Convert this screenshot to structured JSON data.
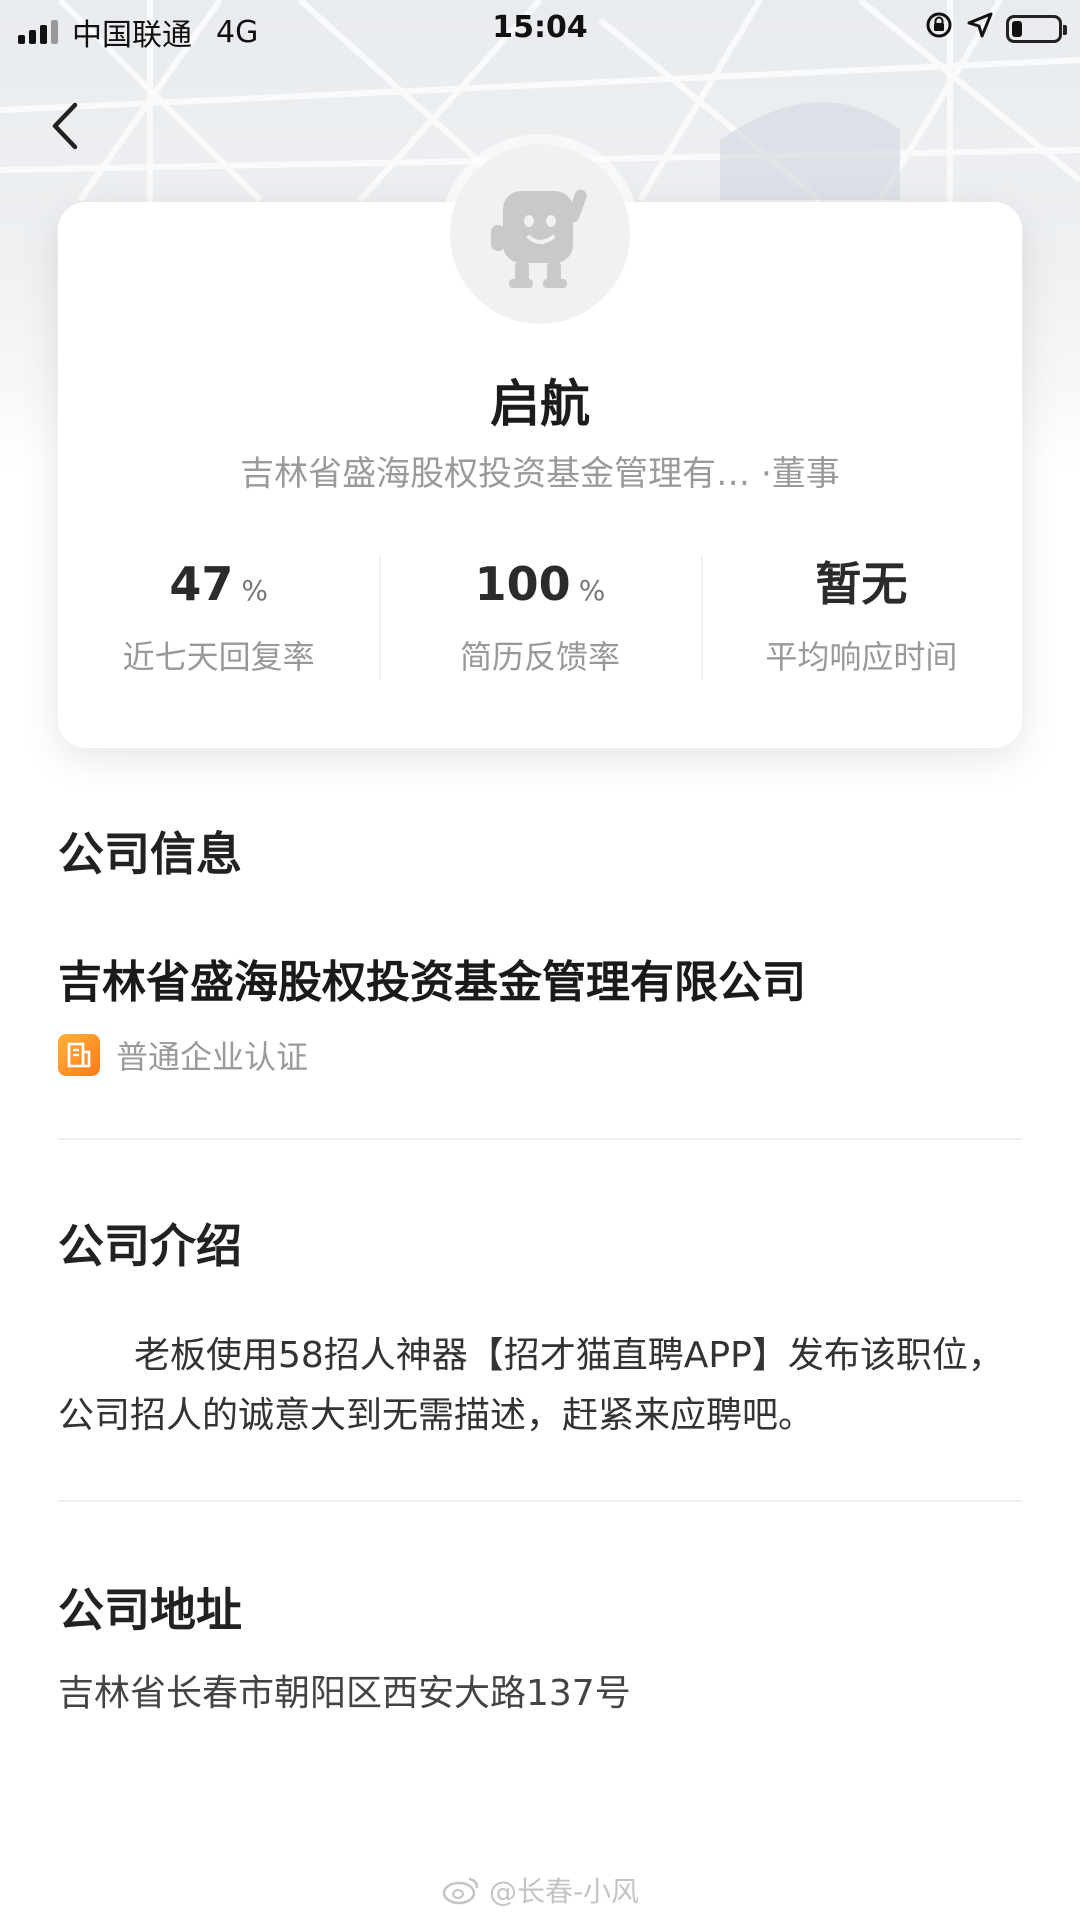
{
  "status_bar": {
    "carrier": "中国联通",
    "network": "4G",
    "time": "15:04"
  },
  "profile": {
    "name": "启航",
    "company_title": "吉林省盛海股权投资基金管理有… ·董事",
    "stats": [
      {
        "value": "47",
        "unit": "%",
        "label": "近七天回复率"
      },
      {
        "value": "100",
        "unit": "%",
        "label": "简历反馈率"
      },
      {
        "value": "暂无",
        "unit": "",
        "label": "平均响应时间"
      }
    ]
  },
  "company_info": {
    "heading": "公司信息",
    "company_name": "吉林省盛海股权投资基金管理有限公司",
    "certification": "普通企业认证"
  },
  "company_intro": {
    "heading": "公司介绍",
    "text": "老板使用58招人神器【招才猫直聘APP】发布该职位，公司招人的诚意大到无需描述，赶紧来应聘吧。"
  },
  "company_address": {
    "heading": "公司地址",
    "address": "吉林省长春市朝阳区西安大路137号"
  },
  "watermark": "@长春-小风",
  "icons": {
    "back": "chevron-left-icon",
    "certification": "building-icon",
    "orientation_lock": "lock-rotation-icon",
    "location": "location-arrow-icon"
  }
}
